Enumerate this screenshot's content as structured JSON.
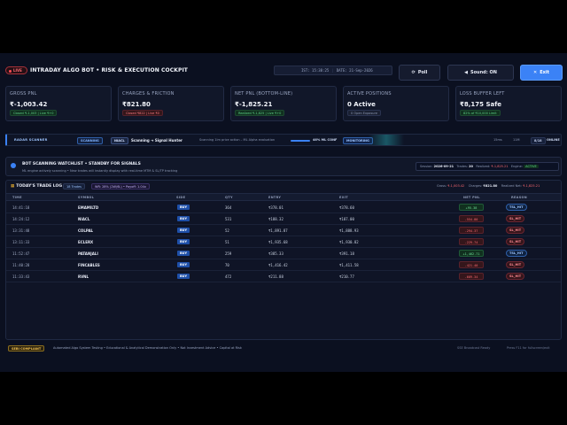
{
  "header": {
    "live_badge": "LIVE",
    "title": "INTRADAY ALGO BOT • RISK & EXECUTION COCKPIT",
    "ist_time": "IST: 15:38:25",
    "date": "DATE: 21-Sep-2026",
    "poll_label": "Poll",
    "sound_label": "Sound: ON",
    "exit_label": "Exit"
  },
  "cards": [
    {
      "label": "GROSS PNL",
      "value": "₹-1,003.42",
      "sub": "Closed ₹-1,003 | Live ₹+0",
      "tone": "green"
    },
    {
      "label": "CHARGES & FRICTION",
      "value": "₹821.80",
      "sub": "Closed ₹822 | Live ₹0",
      "tone": "red"
    },
    {
      "label": "NET PNL (BOTTOM-LINE)",
      "value": "₹-1,825.21",
      "sub": "Realized ₹-1,825 | Live ₹+0",
      "tone": "green"
    },
    {
      "label": "ACTIVE POSITIONS",
      "value": "0 Active",
      "sub": "0 Open Exposure",
      "tone": "grey"
    },
    {
      "label": "LOSS BUFFER LEFT",
      "value": "₹8,175 Safe",
      "sub": "82% of ₹10,000 Limit",
      "tone": "green"
    }
  ],
  "radar": {
    "title": "RADAR SCANNER",
    "scanning": "SCANNING",
    "symbol": "NIACL",
    "flow": "Scanning ➔ Signal Hunter",
    "description": "Scanning 1lm price action – ML Alpha evaluation",
    "confidence": "46% ML CONF",
    "monitoring": "MONITORING",
    "meta1": "15ms",
    "meta2": "11M",
    "queue": "8/18",
    "meta3": "ONLINE",
    "confidence_fraction": 0.46
  },
  "watchlist": {
    "title": "BOT SCANNING WATCHLIST • STANDBY FOR SIGNALS",
    "description": "ML engine actively scanning • New trades will instantly display with real-time MTM & SL/TP tracking",
    "session_label": "Session:",
    "session_value": "2026-09-21",
    "trades_label": "Trades:",
    "trades_value": "20",
    "realized_label": "Realized:",
    "realized_value": "₹-1,825.21",
    "engine_label": "Engine:",
    "engine_value": "ACTIVE"
  },
  "trade_log": {
    "title": "TODAY'S TRADE LOG",
    "count": "18 Trades",
    "winrate": "WR: 28% (2W/6L) • Payoff: 1.04x",
    "gross_label": "Gross:",
    "gross_value": "₹-1,003.42",
    "charges_label": "Charges:",
    "charges_value": "₹821.80",
    "net_label": "Realized Net:",
    "net_value": "₹-1,825.21",
    "columns": [
      "TIME",
      "SYMBOL",
      "SIDE",
      "QTY",
      "ENTRY",
      "EXIT",
      "NET PNL",
      "REASON"
    ],
    "rows": [
      {
        "time": "14:41:18",
        "symbol": "EMAMILTD",
        "side": "BUY",
        "qty": "364",
        "entry": "₹378.01",
        "exit": "₹378.60",
        "pnl": "+95.38",
        "pnl_sign": "pos",
        "reason": "TSL_HIT",
        "reason_type": "tsl"
      },
      {
        "time": "14:24:12",
        "symbol": "NIACL",
        "side": "BUY",
        "qty": "531",
        "entry": "₹188.32",
        "exit": "₹187.00",
        "pnl": "-554.80",
        "pnl_sign": "neg",
        "reason": "SL_HIT",
        "reason_type": "sl"
      },
      {
        "time": "13:31:48",
        "symbol": "COLPAL",
        "side": "BUY",
        "qty": "52",
        "entry": "₹1,891.87",
        "exit": "₹1,888.93",
        "pnl": "-294.37",
        "pnl_sign": "neg",
        "reason": "SL_HIT",
        "reason_type": "sl"
      },
      {
        "time": "13:11:33",
        "symbol": "ECLERX",
        "side": "BUY",
        "qty": "51",
        "entry": "₹1,935.68",
        "exit": "₹1,930.82",
        "pnl": "-229.74",
        "pnl_sign": "neg",
        "reason": "SL_HIT",
        "reason_type": "sl"
      },
      {
        "time": "11:52:47",
        "symbol": "PATANJALI",
        "side": "BUY",
        "qty": "259",
        "entry": "₹385.33",
        "exit": "₹391.18",
        "pnl": "+1,462.71",
        "pnl_sign": "pos",
        "reason": "TSL_HIT",
        "reason_type": "tsl"
      },
      {
        "time": "11:40:28",
        "symbol": "FINCABLES",
        "side": "BUY",
        "qty": "70",
        "entry": "₹1,416.42",
        "exit": "₹1,411.58",
        "pnl": "-421.40",
        "pnl_sign": "neg",
        "reason": "SL_HIT",
        "reason_type": "sl"
      },
      {
        "time": "11:33:43",
        "symbol": "RVNL",
        "side": "BUY",
        "qty": "472",
        "entry": "₹211.88",
        "exit": "₹210.77",
        "pnl": "-609.34",
        "pnl_sign": "neg",
        "reason": "SL_HIT",
        "reason_type": "sl"
      }
    ]
  },
  "footer": {
    "sebi": "SEBI COMPLIANT",
    "disclaimer": "Automated Algo System Testing • Educational & Analytical Demonstration Only • Not Investment Advice • Capital at Risk",
    "right1": "SSE Broadcast Ready",
    "right2": "Press F11 for fullscreen/exit"
  },
  "colors": {
    "accent": "#3b82f6",
    "positive": "#6fe39a",
    "negative": "#ff6b72",
    "background": "#0b1020"
  }
}
